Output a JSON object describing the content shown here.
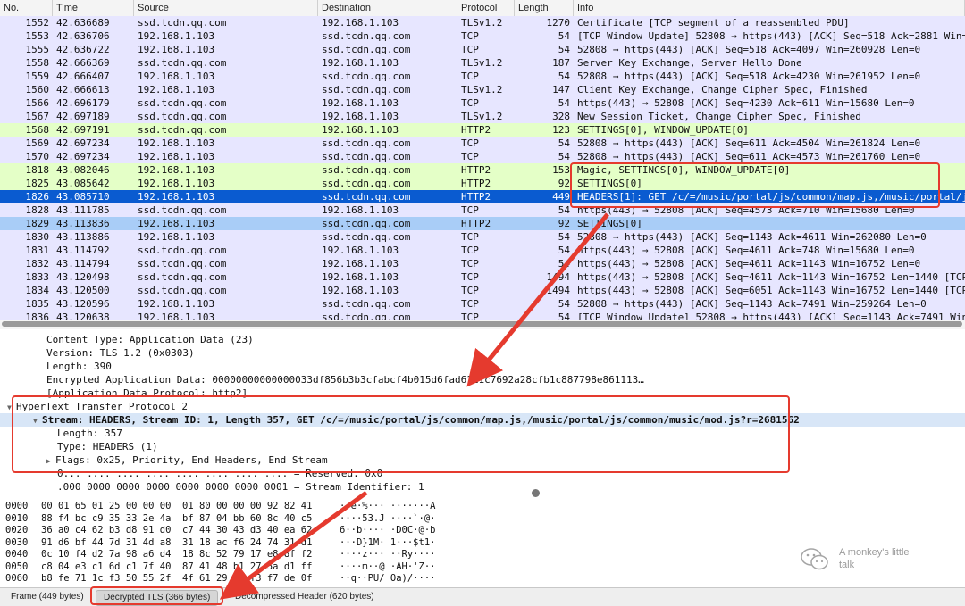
{
  "columns": [
    "No.",
    "Time",
    "Source",
    "Destination",
    "Protocol",
    "Length",
    "Info"
  ],
  "packets": [
    {
      "no": "1552",
      "time": "42.636689",
      "src": "ssd.tcdn.qq.com",
      "dst": "192.168.1.103",
      "proto": "TLSv1.2",
      "len": "1270",
      "info": "Certificate [TCP segment of a reassembled PDU]",
      "kind": "tls"
    },
    {
      "no": "1553",
      "time": "42.636706",
      "src": "192.168.1.103",
      "dst": "ssd.tcdn.qq.com",
      "proto": "TCP",
      "len": "54",
      "info": "[TCP Window Update] 52808 → https(443) [ACK] Seq=518 Ack=2881 Win=2",
      "kind": "tcp"
    },
    {
      "no": "1555",
      "time": "42.636722",
      "src": "192.168.1.103",
      "dst": "ssd.tcdn.qq.com",
      "proto": "TCP",
      "len": "54",
      "info": "52808 → https(443) [ACK] Seq=518 Ack=4097 Win=260928 Len=0",
      "kind": "tcp"
    },
    {
      "no": "1558",
      "time": "42.666369",
      "src": "ssd.tcdn.qq.com",
      "dst": "192.168.1.103",
      "proto": "TLSv1.2",
      "len": "187",
      "info": "Server Key Exchange, Server Hello Done",
      "kind": "tls"
    },
    {
      "no": "1559",
      "time": "42.666407",
      "src": "192.168.1.103",
      "dst": "ssd.tcdn.qq.com",
      "proto": "TCP",
      "len": "54",
      "info": "52808 → https(443) [ACK] Seq=518 Ack=4230 Win=261952 Len=0",
      "kind": "tcp"
    },
    {
      "no": "1560",
      "time": "42.666613",
      "src": "192.168.1.103",
      "dst": "ssd.tcdn.qq.com",
      "proto": "TLSv1.2",
      "len": "147",
      "info": "Client Key Exchange, Change Cipher Spec, Finished",
      "kind": "tls"
    },
    {
      "no": "1566",
      "time": "42.696179",
      "src": "ssd.tcdn.qq.com",
      "dst": "192.168.1.103",
      "proto": "TCP",
      "len": "54",
      "info": "https(443) → 52808 [ACK] Seq=4230 Ack=611 Win=15680 Len=0",
      "kind": "tcp"
    },
    {
      "no": "1567",
      "time": "42.697189",
      "src": "ssd.tcdn.qq.com",
      "dst": "192.168.1.103",
      "proto": "TLSv1.2",
      "len": "328",
      "info": "New Session Ticket, Change Cipher Spec, Finished",
      "kind": "tls"
    },
    {
      "no": "1568",
      "time": "42.697191",
      "src": "ssd.tcdn.qq.com",
      "dst": "192.168.1.103",
      "proto": "HTTP2",
      "len": "123",
      "info": "SETTINGS[0], WINDOW_UPDATE[0]",
      "kind": "http2"
    },
    {
      "no": "1569",
      "time": "42.697234",
      "src": "192.168.1.103",
      "dst": "ssd.tcdn.qq.com",
      "proto": "TCP",
      "len": "54",
      "info": "52808 → https(443) [ACK] Seq=611 Ack=4504 Win=261824 Len=0",
      "kind": "tcp"
    },
    {
      "no": "1570",
      "time": "42.697234",
      "src": "192.168.1.103",
      "dst": "ssd.tcdn.qq.com",
      "proto": "TCP",
      "len": "54",
      "info": "52808 → https(443) [ACK] Seq=611 Ack=4573 Win=261760 Len=0",
      "kind": "tcp"
    },
    {
      "no": "1818",
      "time": "43.082046",
      "src": "192.168.1.103",
      "dst": "ssd.tcdn.qq.com",
      "proto": "HTTP2",
      "len": "153",
      "info": "Magic, SETTINGS[0], WINDOW_UPDATE[0]",
      "kind": "http2"
    },
    {
      "no": "1825",
      "time": "43.085642",
      "src": "192.168.1.103",
      "dst": "ssd.tcdn.qq.com",
      "proto": "HTTP2",
      "len": "92",
      "info": "SETTINGS[0]",
      "kind": "http2"
    },
    {
      "no": "1826",
      "time": "43.085710",
      "src": "192.168.1.103",
      "dst": "ssd.tcdn.qq.com",
      "proto": "HTTP2",
      "len": "449",
      "info": "HEADERS[1]: GET /c/=/music/portal/js/common/map.js,/music/portal/js",
      "kind": "sel"
    },
    {
      "no": "1828",
      "time": "43.111785",
      "src": "ssd.tcdn.qq.com",
      "dst": "192.168.1.103",
      "proto": "TCP",
      "len": "54",
      "info": "https(443) → 52808 [ACK] Seq=4573 Ack=710 Win=15680 Len=0",
      "kind": "tcp"
    },
    {
      "no": "1829",
      "time": "43.113836",
      "src": "192.168.1.103",
      "dst": "ssd.tcdn.qq.com",
      "proto": "HTTP2",
      "len": "92",
      "info": "SETTINGS[0]",
      "kind": "mark"
    },
    {
      "no": "1830",
      "time": "43.113886",
      "src": "192.168.1.103",
      "dst": "ssd.tcdn.qq.com",
      "proto": "TCP",
      "len": "54",
      "info": "52808 → https(443) [ACK] Seq=1143 Ack=4611 Win=262080 Len=0",
      "kind": "tcp"
    },
    {
      "no": "1831",
      "time": "43.114792",
      "src": "ssd.tcdn.qq.com",
      "dst": "192.168.1.103",
      "proto": "TCP",
      "len": "54",
      "info": "https(443) → 52808 [ACK] Seq=4611 Ack=748 Win=15680 Len=0",
      "kind": "tcp"
    },
    {
      "no": "1832",
      "time": "43.114794",
      "src": "ssd.tcdn.qq.com",
      "dst": "192.168.1.103",
      "proto": "TCP",
      "len": "54",
      "info": "https(443) → 52808 [ACK] Seq=4611 Ack=1143 Win=16752 Len=0",
      "kind": "tcp"
    },
    {
      "no": "1833",
      "time": "43.120498",
      "src": "ssd.tcdn.qq.com",
      "dst": "192.168.1.103",
      "proto": "TCP",
      "len": "1494",
      "info": "https(443) → 52808 [ACK] Seq=4611 Ack=1143 Win=16752 Len=1440 [TCP",
      "kind": "tcp"
    },
    {
      "no": "1834",
      "time": "43.120500",
      "src": "ssd.tcdn.qq.com",
      "dst": "192.168.1.103",
      "proto": "TCP",
      "len": "1494",
      "info": "https(443) → 52808 [ACK] Seq=6051 Ack=1143 Win=16752 Len=1440 [TCP",
      "kind": "tcp"
    },
    {
      "no": "1835",
      "time": "43.120596",
      "src": "192.168.1.103",
      "dst": "ssd.tcdn.qq.com",
      "proto": "TCP",
      "len": "54",
      "info": "52808 → https(443) [ACK] Seq=1143 Ack=7491 Win=259264 Len=0",
      "kind": "tcp"
    },
    {
      "no": "1836",
      "time": "43.120638",
      "src": "192.168.1.103",
      "dst": "ssd.tcdn.qq.com",
      "proto": "TCP",
      "len": "54",
      "info": "[TCP Window Update] 52808 → https(443) [ACK] Seq=1143 Ack=7491 Win=",
      "kind": "tcp"
    }
  ],
  "details": [
    {
      "text": "Content Type: Application Data (23)",
      "indent": 1
    },
    {
      "text": "Version: TLS 1.2 (0x0303)",
      "indent": 1
    },
    {
      "text": "Length: 390",
      "indent": 1
    },
    {
      "text": "Encrypted Application Data: 00000000000000033df856b3b3cfabcf4b015d6fad6111c7692a28cfb1c887798e861113…",
      "indent": 1
    },
    {
      "text": "[Application Data Protocol: http2]",
      "indent": 1
    },
    {
      "text": "HyperText Transfer Protocol 2",
      "indent": 0,
      "tri": "▼"
    },
    {
      "text": "Stream: HEADERS, Stream ID: 1, Length 357, GET /c/=/music/portal/js/common/map.js,/music/portal/js/common/music/mod.js?r=2681562",
      "indent": 0.5,
      "tri": "▼",
      "bold": true,
      "sel": true
    },
    {
      "text": "Length: 357",
      "indent": 1.4
    },
    {
      "text": "Type: HEADERS (1)",
      "indent": 1.4
    },
    {
      "text": "Flags: 0x25, Priority, End Headers, End Stream",
      "indent": 1,
      "tri": "▶"
    },
    {
      "text": "0... .... .... .... .... .... .... .... = Reserved: 0x0",
      "indent": 1.4
    },
    {
      "text": ".000 0000 0000 0000 0000 0000 0000 0001 = Stream Identifier: 1",
      "indent": 1.4
    }
  ],
  "bytes": [
    {
      "off": "0000",
      "hex": "00 01 65 01 25 00 00 00  01 80 00 00 00 92 82 41",
      "asc": "··e·%··· ·······A"
    },
    {
      "off": "0010",
      "hex": "88 f4 bc c9 35 33 2e 4a  bf 87 04 bb 60 8c 40 c5",
      "asc": "····53.J ····`·@·"
    },
    {
      "off": "0020",
      "hex": "36 a0 c4 62 b3 d8 91 d0  c7 44 30 43 d3 40 ea 62",
      "asc": "6··b···· ·D0C·@·b"
    },
    {
      "off": "0030",
      "hex": "91 d6 bf 44 7d 31 4d a8  31 18 ac f6 24 74 31 d1",
      "asc": "···D}1M· 1···$t1·"
    },
    {
      "off": "0040",
      "hex": "0c 10 f4 d2 7a 98 a6 d4  18 8c 52 79 17 e8 8f f2",
      "asc": "····z··· ··Ry····"
    },
    {
      "off": "0050",
      "hex": "c8 04 e3 c1 6d c1 7f 40  87 41 48 b1 27 5a d1 ff",
      "asc": "····m··@ ·AH·'Z··"
    },
    {
      "off": "0060",
      "hex": "b8 fe 71 1c f3 50 55 2f  4f 61 29 2f f3 f7 de 0f",
      "asc": "··q··PU/ Oa)/····"
    }
  ],
  "status_tabs": [
    "Frame (449 bytes)",
    "Decrypted TLS (366 bytes)",
    "Decompressed Header (620 bytes)"
  ],
  "watermark": {
    "line1": "A monkey's little",
    "line2": "talk"
  },
  "colors": {
    "accent": "#e53a2e",
    "selected_row": "#0a5bd0",
    "http2_row": "#e4ffc7",
    "tcp_row": "#e7e6ff"
  }
}
